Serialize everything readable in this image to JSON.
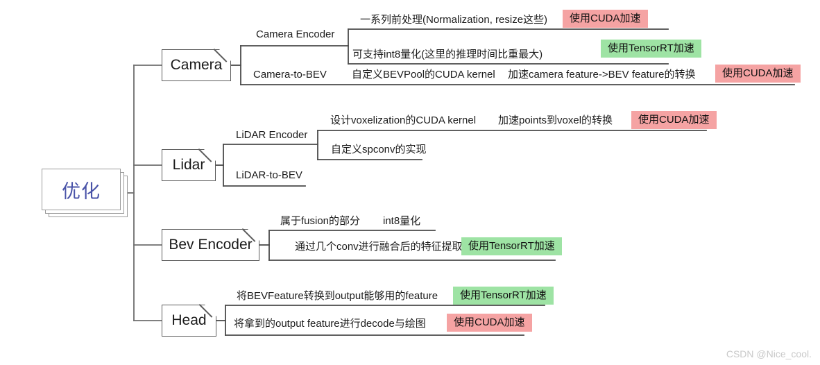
{
  "diagram": {
    "title": "优化",
    "watermark": "CSDN @Nice_cool.",
    "colors": {
      "root_text": "#4953a8",
      "cuda_badge": "#f5a3a3",
      "tensorrt_badge": "#9ee3a4",
      "wire": "#6e6e6e",
      "node_border": "#5a5a5a"
    },
    "root": {
      "label": "优化"
    },
    "branches": [
      {
        "id": "camera",
        "label": "Camera",
        "children": [
          {
            "id": "camera-encoder",
            "label": "Camera Encoder",
            "items": [
              {
                "text": "一系列前处理(Normalization, resize这些)",
                "badge": "使用CUDA加速",
                "badge_kind": "cuda"
              },
              {
                "text": "可支持int8量化(这里的推理时间比重最大)",
                "badge": "使用TensorRT加速",
                "badge_kind": "tensorrt"
              }
            ]
          },
          {
            "id": "camera-to-bev",
            "label": "Camera-to-BEV",
            "items": [
              {
                "text": "自定义BEVPool的CUDA kernel",
                "text2": "加速camera feature->BEV feature的转换",
                "badge": "使用CUDA加速",
                "badge_kind": "cuda"
              }
            ]
          }
        ]
      },
      {
        "id": "lidar",
        "label": "Lidar",
        "children": [
          {
            "id": "lidar-encoder",
            "label": "LiDAR Encoder",
            "items": [
              {
                "text": "设计voxelization的CUDA kernel",
                "text2": "加速points到voxel的转换",
                "badge": "使用CUDA加速",
                "badge_kind": "cuda"
              },
              {
                "text": "自定义spconv的实现",
                "badge": "",
                "badge_kind": ""
              }
            ]
          },
          {
            "id": "lidar-to-bev",
            "label": "LiDAR-to-BEV",
            "items": []
          }
        ]
      },
      {
        "id": "bev-encoder",
        "label": "Bev Encoder",
        "children": [
          {
            "id": "bev-fusion-part",
            "label": "属于fusion的部分",
            "label2": "int8量化",
            "items": [
              {
                "text": "通过几个conv进行融合后的特征提取",
                "badge": "使用TensorRT加速",
                "badge_kind": "tensorrt"
              }
            ]
          }
        ]
      },
      {
        "id": "head",
        "label": "Head",
        "children": [
          {
            "id": "head-items",
            "label": "",
            "items": [
              {
                "text": "将BEVFeature转换到output能够用的feature",
                "badge": "使用TensorRT加速",
                "badge_kind": "tensorrt"
              },
              {
                "text": "将拿到的output feature进行decode与绘图",
                "badge": "使用CUDA加速",
                "badge_kind": "cuda"
              }
            ]
          }
        ]
      }
    ],
    "text_labels": {
      "camera_encoder": "Camera Encoder",
      "camera_to_bev": "Camera-to-BEV",
      "lidar_encoder": "LiDAR Encoder",
      "lidar_to_bev": "LiDAR-to-BEV",
      "bev_fusion": "属于fusion的部分",
      "bev_int8": "int8量化",
      "cam_pre": "一系列前处理(Normalization, resize这些)",
      "cam_int8": "可支持int8量化(这里的推理时间比重最大)",
      "cam_bevpool": "自定义BEVPool的CUDA kernel",
      "cam_accel": "加速camera feature->BEV feature的转换",
      "lidar_voxel_kernel": "设计voxelization的CUDA kernel",
      "lidar_points_voxel": "加速points到voxel的转换",
      "lidar_spconv": "自定义spconv的实现",
      "bev_conv": "通过几个conv进行融合后的特征提取",
      "head_bevfeature": "将BEVFeature转换到output能够用的feature",
      "head_decode": "将拿到的output feature进行decode与绘图"
    },
    "badges": {
      "cuda": "使用CUDA加速",
      "tensorrt": "使用TensorRT加速"
    }
  }
}
